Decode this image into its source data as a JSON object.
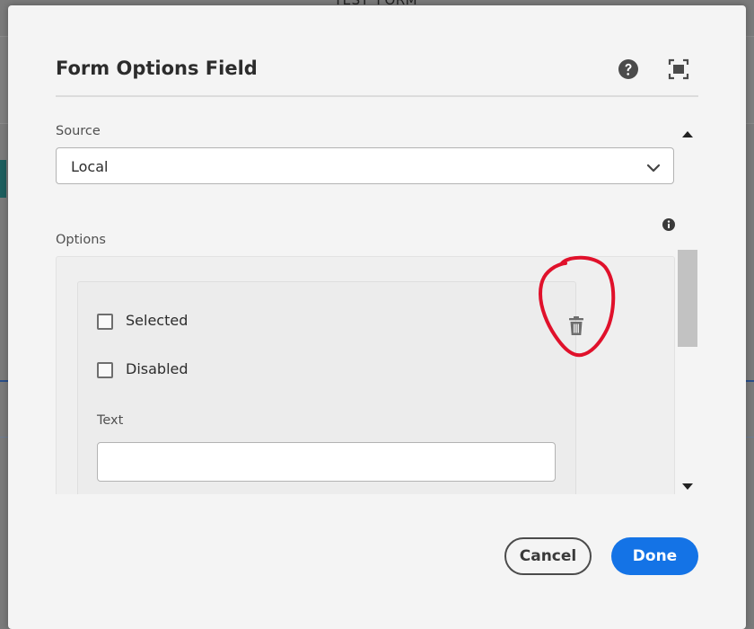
{
  "background": {
    "page_title": "TEST_FORM"
  },
  "dialog": {
    "title": "Form Options Field",
    "help_icon": "help-circle-icon",
    "fullscreen_icon": "fullscreen-icon"
  },
  "source": {
    "label": "Source",
    "value": "Local"
  },
  "options": {
    "label": "Options",
    "info_icon": "info-icon",
    "items": [
      {
        "selected_label": "Selected",
        "selected_checked": false,
        "disabled_label": "Disabled",
        "disabled_checked": false,
        "text_label": "Text",
        "text_value": ""
      }
    ]
  },
  "footer": {
    "cancel_label": "Cancel",
    "done_label": "Done"
  },
  "colors": {
    "accent": "#1473e6",
    "annotation": "#e0112b"
  }
}
